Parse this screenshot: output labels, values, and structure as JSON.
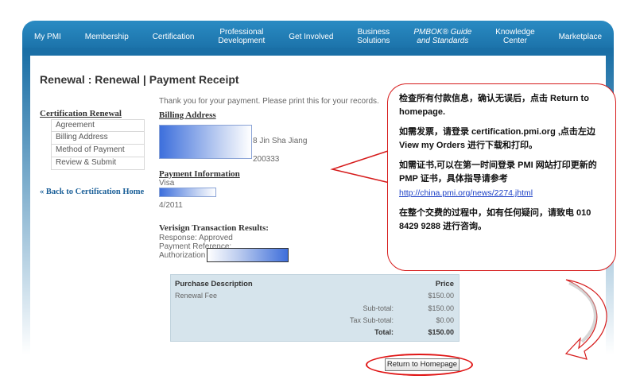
{
  "nav": {
    "items": [
      {
        "label": "My PMI",
        "italic": false
      },
      {
        "label": "Membership",
        "italic": false
      },
      {
        "label": "Certification",
        "italic": false
      },
      {
        "label": "Professional\nDevelopment",
        "italic": false
      },
      {
        "label": "Get Involved",
        "italic": false
      },
      {
        "label": "Business\nSolutions",
        "italic": false
      },
      {
        "label": "PMBOK® Guide\nand Standards",
        "italic": true
      },
      {
        "label": "Knowledge\nCenter",
        "italic": false
      },
      {
        "label": "Marketplace",
        "italic": false
      }
    ]
  },
  "page": {
    "title": "Renewal : Renewal | Payment Receipt"
  },
  "sidebar": {
    "heading": "Certification Renewal",
    "items": [
      "Agreement",
      "Billing Address",
      "Method of Payment",
      "Review & Submit"
    ],
    "back_link": "« Back to Certification Home"
  },
  "receipt": {
    "thanks": "Thank you for your payment. Please print this for your records.",
    "billing_heading": "Billing Address",
    "billing_line1": "8 Jin Sha Jiang",
    "billing_zip": "200333",
    "payment_heading": "Payment Information",
    "card_type": "Visa",
    "card_expiry": "4/2011",
    "verisign_heading": "Verisign Transaction Results:",
    "response": "Response: Approved",
    "payment_reference": "Payment Reference:",
    "authorization_code": "Authorization Code:"
  },
  "purchase_table": {
    "col_description": "Purchase Description",
    "col_price": "Price",
    "item_name": "Renewal Fee",
    "item_price": "$150.00",
    "subtotal_label": "Sub-total:",
    "subtotal_value": "$150.00",
    "tax_label": "Tax Sub-total:",
    "tax_value": "$0.00",
    "total_label": "Total:",
    "total_value": "$150.00"
  },
  "buttons": {
    "return_home": "Return to Homepage"
  },
  "callout": {
    "p1": "检查所有付款信息，确认无误后，点击 Return to homepage.",
    "p2": "如需发票，请登录 certification.pmi.org ,点击左边 View my Orders 进行下载和打印。",
    "p3": "如需证书,可以在第一时间登录 PMI 网站打印更新的 PMP 证书，具体指导请参考",
    "p3_link": "http://china.pmi.org/news/2274.jhtml",
    "p4": "在整个交费的过程中，如有任何疑问，请致电 010 8429 9288 进行咨询。"
  },
  "colors": {
    "nav_blue": "#1a6fa6",
    "annotation_red": "#d61b1b",
    "link_blue": "#1a5f98",
    "table_bg": "#d6e4ec"
  }
}
